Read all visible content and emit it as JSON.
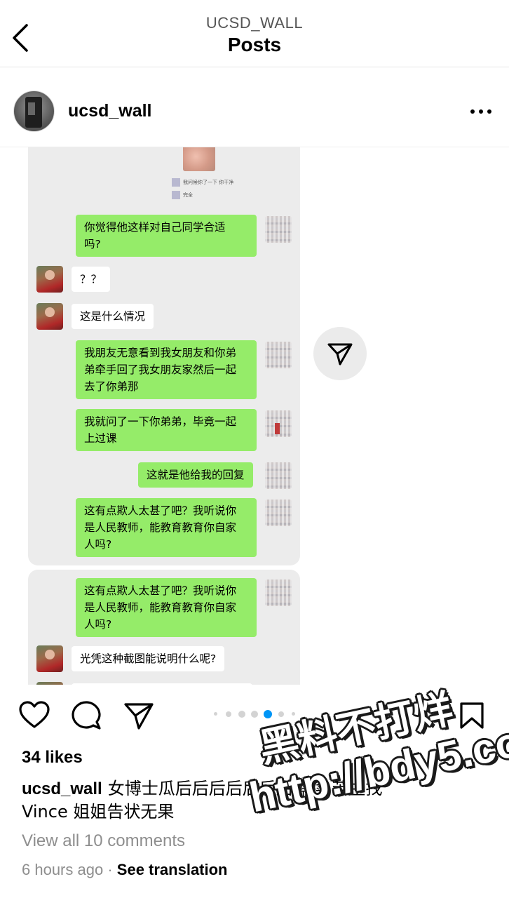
{
  "header": {
    "account": "UCSD_WALL",
    "title": "Posts"
  },
  "post": {
    "username": "ucsd_wall",
    "likes": "34 likes",
    "caption_text": "女博士瓜后后后后后后后需续 苦主找 Vince 姐姐告状无果",
    "view_comments": "View all 10 comments",
    "time": "6 hours ago",
    "separator": "·",
    "see_translation": "See translation",
    "carousel": {
      "count": 6,
      "active_index": 4
    }
  },
  "chat_image": {
    "mini_line1": "我问候你了一下 你干净",
    "mini_line2": "完全",
    "messages": [
      {
        "side": "right",
        "text_lines": [
          "你觉得他这样对自己同学合适",
          "吗?"
        ]
      },
      {
        "side": "left",
        "text_lines": [
          "？？"
        ]
      },
      {
        "side": "left",
        "text_lines": [
          "这是什么情况"
        ]
      },
      {
        "side": "right",
        "text_lines": [
          "我朋友无意看到我女朋友和你弟",
          "弟牵手回了我女朋友家然后一起",
          "去了你弟那"
        ]
      },
      {
        "side": "right",
        "text_lines": [
          "我就问了一下你弟弟，毕竟一起",
          "上过课"
        ]
      },
      {
        "side": "right",
        "text_lines": [
          "这就是他给我的回复"
        ]
      },
      {
        "side": "right",
        "text_lines": [
          "这有点欺人太甚了吧？我听说你",
          "是人民教师，能教育教育你自家",
          "人吗?"
        ]
      },
      {
        "side": "right",
        "text_lines": [
          "这有点欺人太甚了吧？我听说你",
          "是人民教师，能教育教育你自家",
          "人吗?"
        ]
      },
      {
        "side": "left",
        "text_lines": [
          "光凭这种截图能说明什么呢?"
        ]
      }
    ]
  },
  "watermark": {
    "line1": "黑料不打烊",
    "line2": "http://bdy5.co"
  },
  "colors": {
    "wechat_green": "#95ec69",
    "carousel_active": "#0095f6"
  },
  "icons": [
    "back-icon",
    "more-icon",
    "share-icon",
    "heart-icon",
    "comment-icon",
    "send-icon",
    "bookmark-icon"
  ]
}
